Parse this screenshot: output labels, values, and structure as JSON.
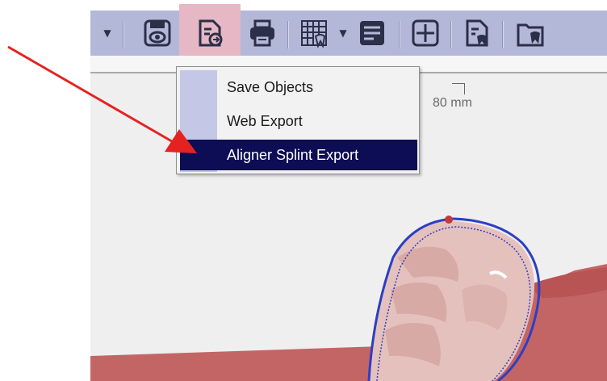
{
  "toolbar": {
    "buttons": [
      {
        "name": "save-view-icon"
      },
      {
        "name": "export-document-icon"
      },
      {
        "name": "print-icon"
      },
      {
        "name": "grid-tooth-icon"
      },
      {
        "name": "panel-icon"
      },
      {
        "name": "crosshair-icon"
      },
      {
        "name": "document-tooth-icon"
      },
      {
        "name": "folder-tooth-icon"
      }
    ],
    "arrow_glyph": "▼",
    "active_color": "#e6b7c4",
    "background_color": "#b4b8d8"
  },
  "viewport": {
    "ruler_label": "80 mm",
    "tissue_color": "#c46565",
    "tooth_color": "#e5c1bd",
    "outline_color": "#2b3fc4"
  },
  "menu": {
    "items": [
      {
        "label": "Save Objects"
      },
      {
        "label": "Web Export"
      },
      {
        "label": "Aligner Splint Export"
      }
    ],
    "selected_index": 2,
    "selected_color": "#0d0d55"
  },
  "annotation": {
    "arrow_color": "#e52222"
  }
}
